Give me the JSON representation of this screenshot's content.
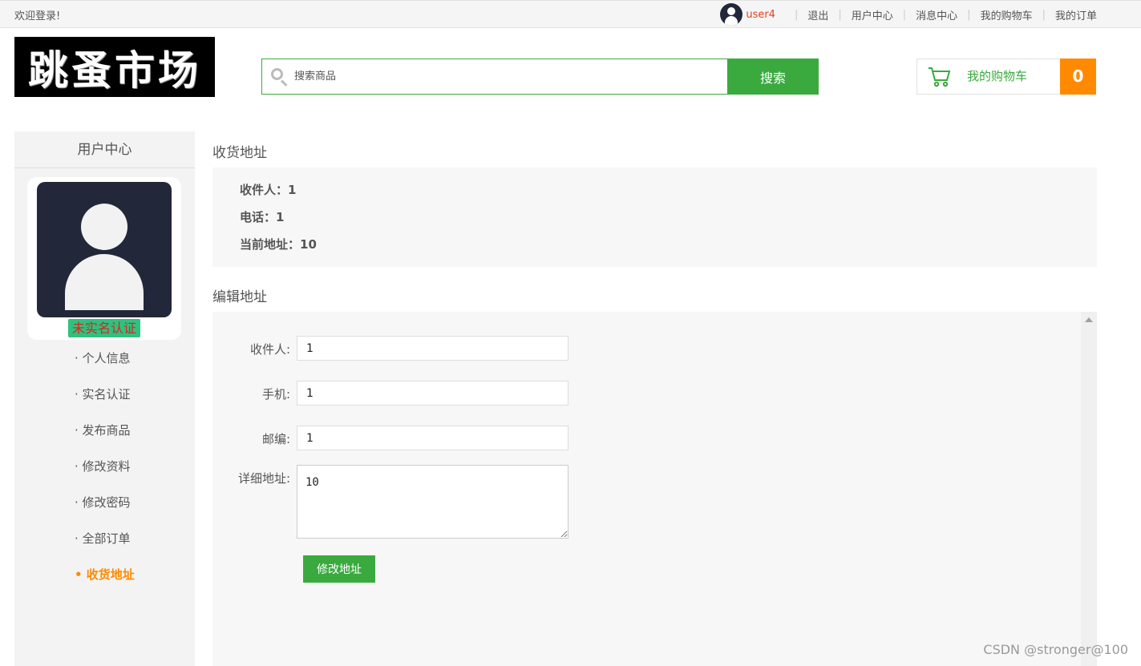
{
  "topbar": {
    "welcome": "欢迎登录!",
    "username": "user4",
    "links": [
      "退出",
      "用户中心",
      "消息中心",
      "我的购物车",
      "我的订单"
    ]
  },
  "header": {
    "logo_text": "跳蚤市场",
    "search": {
      "placeholder": "搜索商品",
      "button": "搜索"
    },
    "cart": {
      "label": "我的购物车",
      "count": "0"
    }
  },
  "sidebar": {
    "title": "用户中心",
    "verify_status": "未实名认证",
    "menu": [
      {
        "label": "· 个人信息"
      },
      {
        "label": "· 实名认证"
      },
      {
        "label": "· 发布商品"
      },
      {
        "label": "· 修改资料"
      },
      {
        "label": "· 修改密码"
      },
      {
        "label": "· 全部订单"
      },
      {
        "label": "• 收货地址"
      }
    ]
  },
  "address": {
    "title": "收货地址",
    "recipient": "收件人：1",
    "phone": "电话：1",
    "current": "当前地址：10"
  },
  "edit": {
    "title": "编辑地址",
    "recipient_label": "收件人:",
    "recipient_value": "1",
    "phone_label": "手机:",
    "phone_value": "1",
    "zip_label": "邮编:",
    "zip_value": "1",
    "detail_label": "详细地址:",
    "detail_value": "10",
    "submit": "修改地址"
  },
  "watermark": "CSDN @stronger@100",
  "colors": {
    "accent_green": "#3aaa3f",
    "accent_orange": "#ff8a00",
    "username_red": "#e8401c"
  }
}
